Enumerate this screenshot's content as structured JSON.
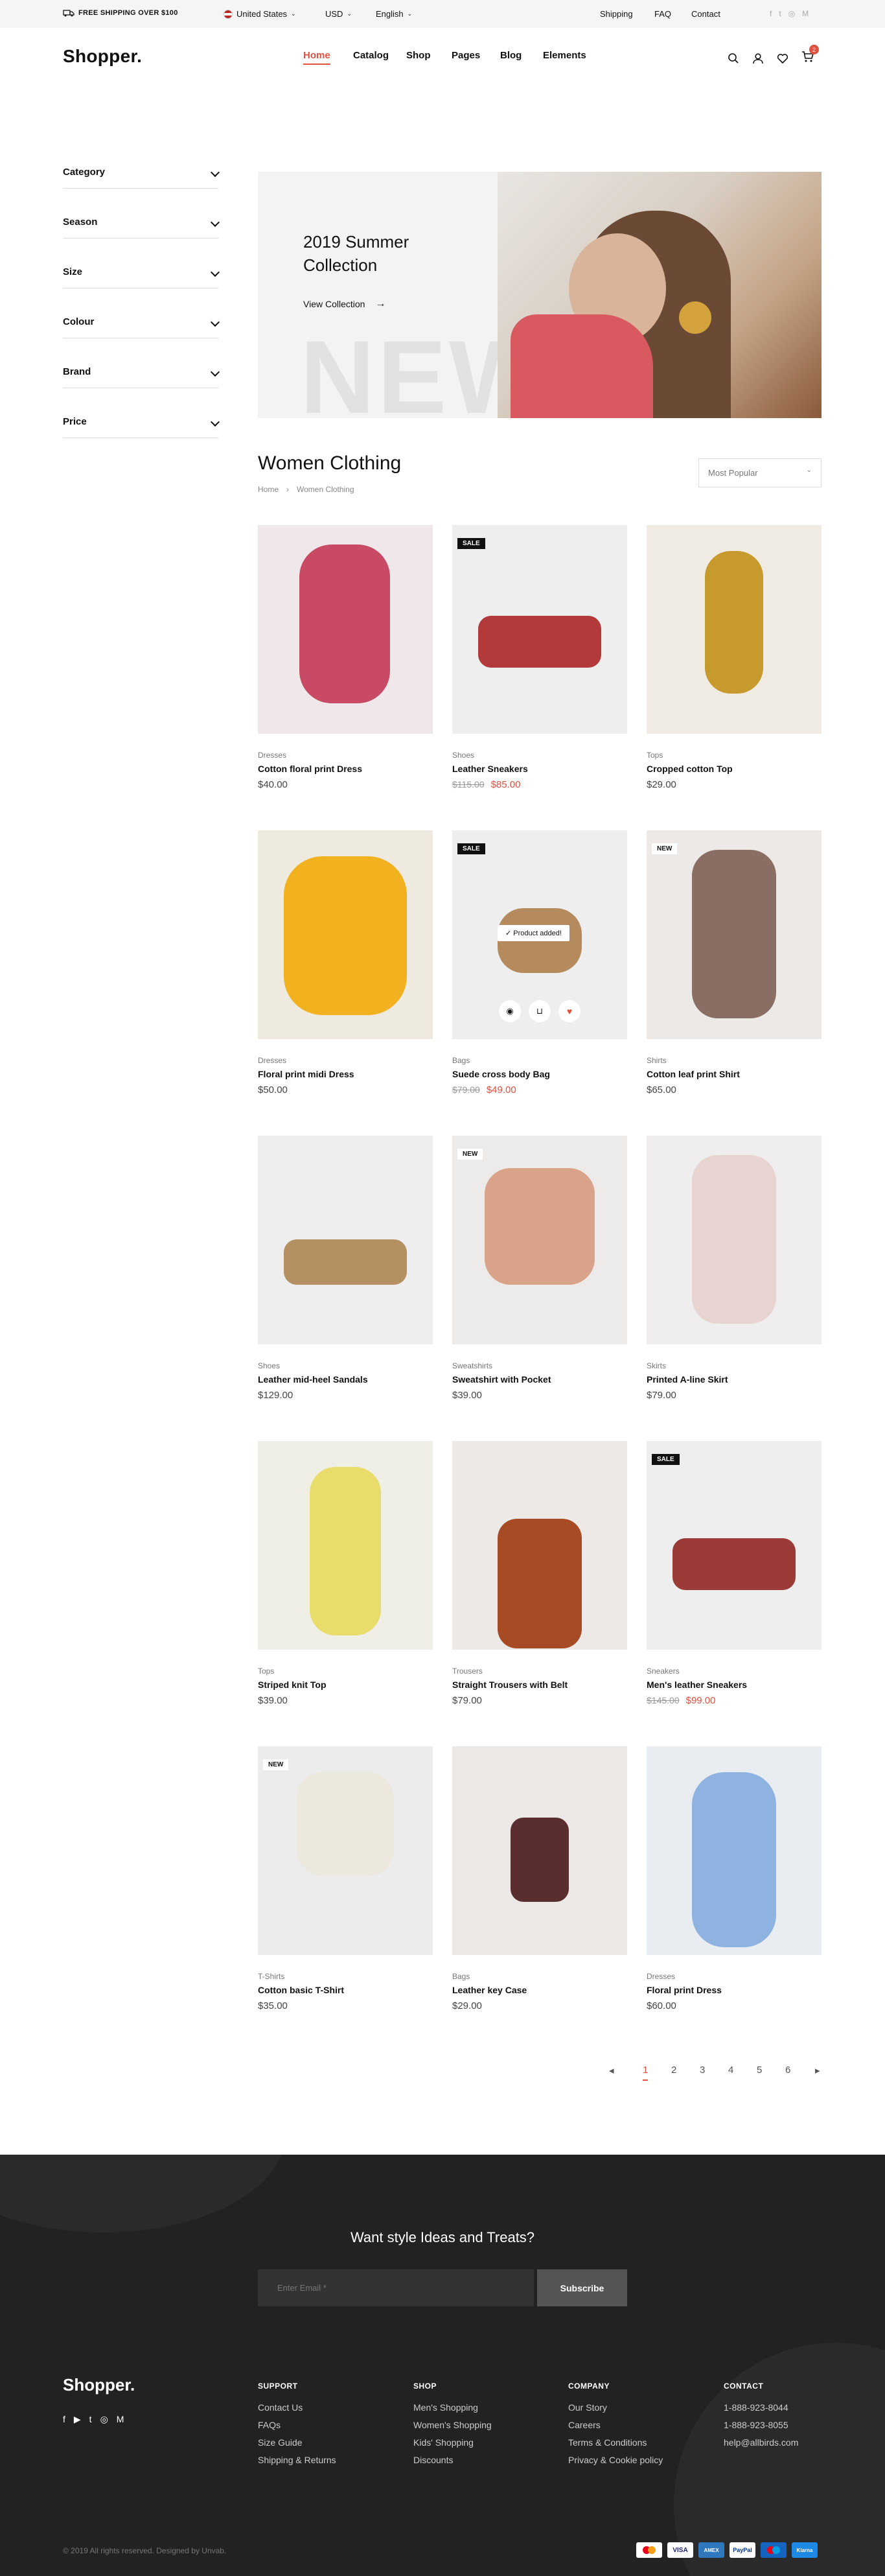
{
  "topbar": {
    "shipping_note": "FREE SHIPPING OVER $100",
    "country": "United States",
    "currency": "USD",
    "language": "English",
    "links": [
      "Shipping",
      "FAQ",
      "Contact"
    ]
  },
  "header": {
    "logo": "Shopper.",
    "nav": [
      "Home",
      "Catalog",
      "Shop",
      "Pages",
      "Blog",
      "Elements"
    ],
    "cart_count": "2",
    "accent": "#e2503f"
  },
  "sidebar": {
    "filters": [
      "Category",
      "Season",
      "Size",
      "Colour",
      "Brand",
      "Price"
    ]
  },
  "hero": {
    "title_line1": "2019 Summer",
    "title_line2": "Collection",
    "cta": "View Collection",
    "watermark": "NEW"
  },
  "listing": {
    "title": "Women Clothing",
    "breadcrumb": [
      "Home",
      "Women Clothing"
    ],
    "sort_selected": "Most Popular"
  },
  "products": [
    {
      "category": "Dresses",
      "name": "Cotton floral print Dress",
      "price": "$40.00",
      "old_price": "",
      "badge": ""
    },
    {
      "category": "Shoes",
      "name": "Leather Sneakers",
      "price": "$85.00",
      "old_price": "$115.00",
      "badge": "SALE"
    },
    {
      "category": "Tops",
      "name": "Cropped cotton Top",
      "price": "$29.00",
      "old_price": "",
      "badge": ""
    },
    {
      "category": "Dresses",
      "name": "Floral print midi Dress",
      "price": "$50.00",
      "old_price": "",
      "badge": ""
    },
    {
      "category": "Bags",
      "name": "Suede cross body Bag",
      "price": "$49.00",
      "old_price": "$79.00",
      "badge": "SALE",
      "toast": "Product added!"
    },
    {
      "category": "Shirts",
      "name": "Cotton leaf print Shirt",
      "price": "$65.00",
      "old_price": "",
      "badge": "NEW"
    },
    {
      "category": "Shoes",
      "name": "Leather mid-heel Sandals",
      "price": "$129.00",
      "old_price": "",
      "badge": ""
    },
    {
      "category": "Sweatshirts",
      "name": "Sweatshirt with Pocket",
      "price": "$39.00",
      "old_price": "",
      "badge": "NEW"
    },
    {
      "category": "Skirts",
      "name": "Printed A-line Skirt",
      "price": "$79.00",
      "old_price": "",
      "badge": ""
    },
    {
      "category": "Tops",
      "name": "Striped knit Top",
      "price": "$39.00",
      "old_price": "",
      "badge": ""
    },
    {
      "category": "Trousers",
      "name": "Straight Trousers with Belt",
      "price": "$79.00",
      "old_price": "",
      "badge": ""
    },
    {
      "category": "Sneakers",
      "name": "Men's leather Sneakers",
      "price": "$99.00",
      "old_price": "$145.00",
      "badge": "SALE"
    },
    {
      "category": "T-Shirts",
      "name": "Cotton basic T-Shirt",
      "price": "$35.00",
      "old_price": "",
      "badge": "NEW"
    },
    {
      "category": "Bags",
      "name": "Leather key Case",
      "price": "$29.00",
      "old_price": "",
      "badge": ""
    },
    {
      "category": "Dresses",
      "name": "Floral print Dress",
      "price": "$60.00",
      "old_price": "",
      "badge": ""
    }
  ],
  "pagination": {
    "pages": [
      "1",
      "2",
      "3",
      "4",
      "5",
      "6"
    ],
    "current": "1"
  },
  "newsletter": {
    "heading": "Want style Ideas and Treats?",
    "placeholder": "Enter Email *",
    "button": "Subscribe"
  },
  "footer": {
    "logo": "Shopper.",
    "columns": [
      {
        "title": "SUPPORT",
        "items": [
          "Contact Us",
          "FAQs",
          "Size Guide",
          "Shipping & Returns"
        ]
      },
      {
        "title": "SHOP",
        "items": [
          "Men's Shopping",
          "Women's Shopping",
          "Kids' Shopping",
          "Discounts"
        ]
      },
      {
        "title": "COMPANY",
        "items": [
          "Our Story",
          "Careers",
          "Terms & Conditions",
          "Privacy & Cookie policy"
        ]
      },
      {
        "title": "CONTACT",
        "items": [
          "1-888-923-8044",
          "1-888-923-8055",
          "help@allbirds.com"
        ]
      }
    ],
    "copyright": "© 2019 All rights reserved. Designed by Unvab.",
    "payments": [
      "VISA",
      "AMEX",
      "PayPal",
      "Klarna"
    ]
  }
}
